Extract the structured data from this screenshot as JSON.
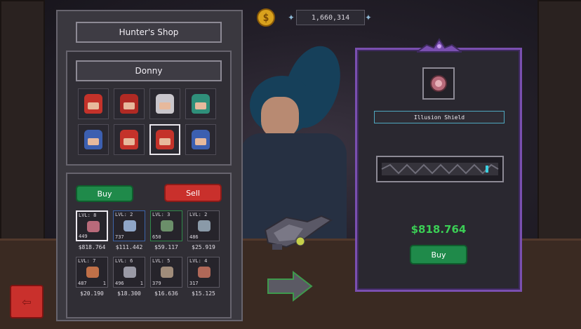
{
  "currency": {
    "icon": "coin-icon",
    "symbol": "$",
    "amount": "1,660,314"
  },
  "shop": {
    "title": "Hunter's Shop",
    "hunter_name": "Donny",
    "buy_label": "Buy",
    "sell_label": "Sell",
    "heroes": [
      {
        "name": "hero-red-hood",
        "color": "#c4322a",
        "selected": false
      },
      {
        "name": "hero-red-hat",
        "color": "#b02a24",
        "selected": false
      },
      {
        "name": "hero-knight",
        "color": "#c9c6cc",
        "selected": false
      },
      {
        "name": "hero-green-hood",
        "color": "#2f8f7a",
        "selected": false
      },
      {
        "name": "hero-blue-wizard",
        "color": "#3c5fb0",
        "selected": false
      },
      {
        "name": "hero-red-hood-2",
        "color": "#c4322a",
        "selected": false
      },
      {
        "name": "hero-red-hood-3",
        "color": "#c4322a",
        "selected": true
      },
      {
        "name": "hero-blue-wizard-2",
        "color": "#3c5fb0",
        "selected": false
      }
    ],
    "items": [
      {
        "level": "LVL: 8",
        "qty": "449",
        "count": "",
        "price": "$818.764",
        "icon_color": "#b86a7a",
        "border": "sel"
      },
      {
        "level": "LVL: 2",
        "qty": "737",
        "count": "",
        "price": "$111.442",
        "icon_color": "#8fa6c8",
        "border": "blue"
      },
      {
        "level": "LVL: 3",
        "qty": "650",
        "count": "",
        "price": "$59.117",
        "icon_color": "#6b8f6a",
        "border": "green"
      },
      {
        "level": "LVL: 2",
        "qty": "486",
        "count": "",
        "price": "$25.919",
        "icon_color": "#8a9aa8",
        "border": ""
      },
      {
        "level": "LVL: 7",
        "qty": "487",
        "count": "1",
        "price": "$20.190",
        "icon_color": "#c07048",
        "border": ""
      },
      {
        "level": "LVL: 6",
        "qty": "496",
        "count": "1",
        "price": "$18.300",
        "icon_color": "#9a9aa6",
        "border": ""
      },
      {
        "level": "LVL: 5",
        "qty": "379",
        "count": "",
        "price": "$16.636",
        "icon_color": "#a08c7a",
        "border": ""
      },
      {
        "level": "LVL: 4",
        "qty": "317",
        "count": "",
        "price": "$15.125",
        "icon_color": "#b06858",
        "border": ""
      }
    ]
  },
  "detail": {
    "item_name": "Illusion Shield",
    "price": "$818.764",
    "buy_label": "Buy",
    "icon": "illusion-shield-icon"
  },
  "colors": {
    "accent_purple": "#7a4fb0",
    "buy_green": "#1f8a4a",
    "sell_red": "#c9302c",
    "price_green": "#3bcf55"
  }
}
